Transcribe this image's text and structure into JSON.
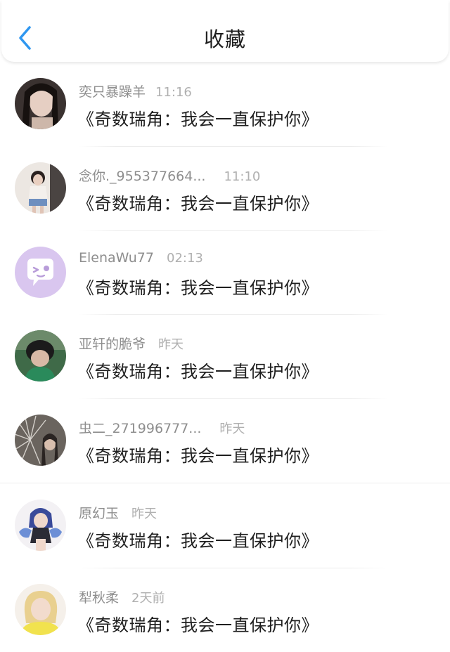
{
  "header": {
    "title": "收藏",
    "back_icon": "chevron-left-icon",
    "accent": "#2f97f0"
  },
  "items": [
    {
      "name": "奕只暴躁羊",
      "time": "11:16",
      "content": "《奇数瑞角：我会一直保护你》",
      "avatar": "photo-avatar"
    },
    {
      "name": "念你._955377664...",
      "time": "11:10",
      "content": "《奇数瑞角：我会一直保护你》",
      "avatar": "photo-avatar"
    },
    {
      "name": "ElenaWu77",
      "time": "02:13",
      "content": "《奇数瑞角：我会一直保护你》",
      "avatar": "chat-bubble-avatar"
    },
    {
      "name": "亚轩的脆爷",
      "time": "昨天",
      "content": "《奇数瑞角：我会一直保护你》",
      "avatar": "photo-avatar"
    },
    {
      "name": "虫二_271996777...",
      "time": "昨天",
      "content": "《奇数瑞角：我会一直保护你》",
      "avatar": "photo-avatar"
    },
    {
      "name": "原幻玉",
      "time": "昨天",
      "content": "《奇数瑞角：我会一直保护你》",
      "avatar": "anime-avatar"
    },
    {
      "name": "犁秋柔",
      "time": "2天前",
      "content": "《奇数瑞角：我会一直保护你》",
      "avatar": "photo-avatar"
    }
  ]
}
